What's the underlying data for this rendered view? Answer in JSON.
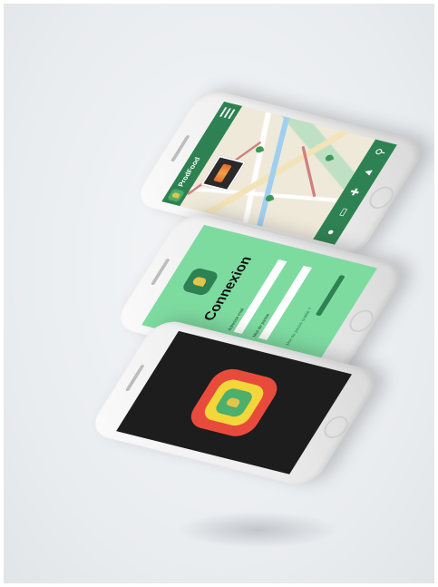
{
  "map_app": {
    "brand": "ProdFood",
    "bottom_icons": [
      "profile-icon",
      "card-icon",
      "plus-icon",
      "notification-icon",
      "search-icon"
    ]
  },
  "login": {
    "title": "Connexion",
    "fields": [
      {
        "label": "Adresse mail",
        "value": ""
      },
      {
        "label": "Mot de passe",
        "value": ""
      }
    ],
    "forgot_text": "Mot de passe oublié ?"
  },
  "colors": {
    "primary_green": "#2e8152",
    "light_green": "#7ddba0",
    "splash_bg": "#1d1d1d",
    "ring_red": "#e84b3c",
    "ring_yellow": "#f3d73a"
  }
}
